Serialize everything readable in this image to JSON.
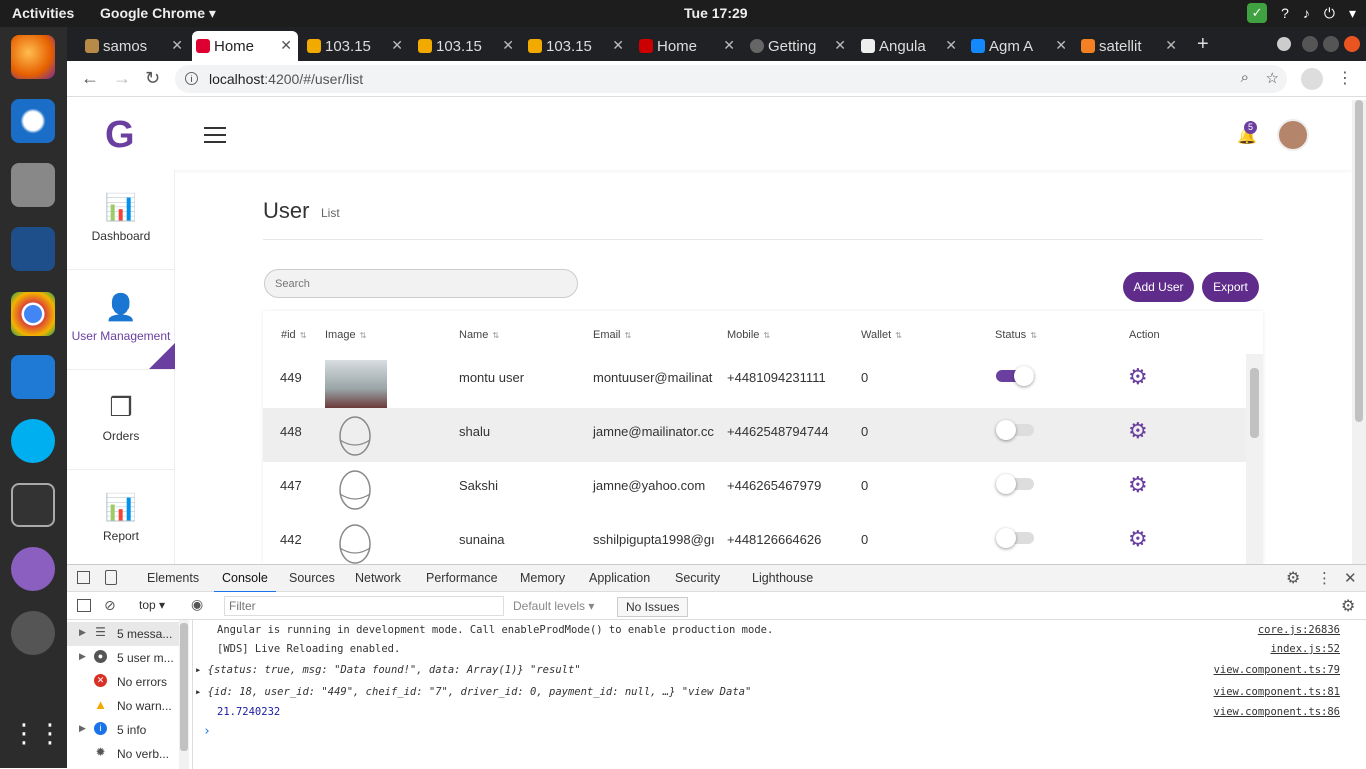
{
  "os": {
    "activities": "Activities",
    "app": "Google Chrome ▾",
    "clock": "Tue 17:29"
  },
  "browser": {
    "tabs": [
      "samos",
      "Home",
      "103.15",
      "103.15",
      "103.15",
      "Home",
      "Getting",
      "Angula",
      "Agm A",
      "satellit"
    ],
    "url_host": "localhost",
    "url_rest": ":4200/#/user/list"
  },
  "app": {
    "logo": "G",
    "notification_count": "5",
    "sidebar": [
      {
        "label": "Dashboard",
        "icon": "chart-icon"
      },
      {
        "label": "User Management",
        "icon": "user-add-icon"
      },
      {
        "label": "Orders",
        "icon": "boxes-icon"
      },
      {
        "label": "Report",
        "icon": "chart-icon"
      }
    ],
    "page_title": "User",
    "page_subtitle": "List",
    "search_placeholder": "Search",
    "add_user": "Add User",
    "export": "Export",
    "columns": [
      "#id",
      "Image",
      "Name",
      "Email",
      "Mobile",
      "Wallet",
      "Status",
      "Action"
    ],
    "rows": [
      {
        "id": "449",
        "name": "montu user",
        "email": "montuuser@mailinat",
        "mobile": "+4481094231111",
        "wallet": "0",
        "status": true
      },
      {
        "id": "448",
        "name": "shalu",
        "email": "jamne@mailinator.cc",
        "mobile": "+4462548794744",
        "wallet": "0",
        "status": false
      },
      {
        "id": "447",
        "name": "Sakshi",
        "email": "jamne@yahoo.com",
        "mobile": "+446265467979",
        "wallet": "0",
        "status": false
      },
      {
        "id": "442",
        "name": "sunaina",
        "email": "sshilpigupta1998@gı",
        "mobile": "+448126664626",
        "wallet": "0",
        "status": false
      }
    ]
  },
  "devtools": {
    "tabs": [
      "Elements",
      "Console",
      "Sources",
      "Network",
      "Performance",
      "Memory",
      "Application",
      "Security",
      "Lighthouse"
    ],
    "context": "top",
    "filter_placeholder": "Filter",
    "levels": "Default levels",
    "issues": "No Issues",
    "sidebar": [
      "5 messa...",
      "5 user m...",
      "No errors",
      "No warn...",
      "5 info",
      "No verb..."
    ],
    "logs": [
      {
        "text": "Angular is running in development mode. Call enableProdMode() to enable production mode.",
        "src": "core.js:26836"
      },
      {
        "text": "[WDS] Live Reloading enabled.",
        "src": "index.js:52"
      },
      {
        "text": "▸ {status: true, msg: \"Data found!\", data: Array(1)} \"result\"",
        "src": "view.component.ts:79"
      },
      {
        "text": "▸ {id: 18, user_id: \"449\", cheif_id: \"7\", driver_id: 0, payment_id: null, …} \"view Data\"",
        "src": "view.component.ts:81"
      },
      {
        "text": "21.7240232",
        "src": "view.component.ts:86"
      }
    ],
    "prompt": "›"
  }
}
